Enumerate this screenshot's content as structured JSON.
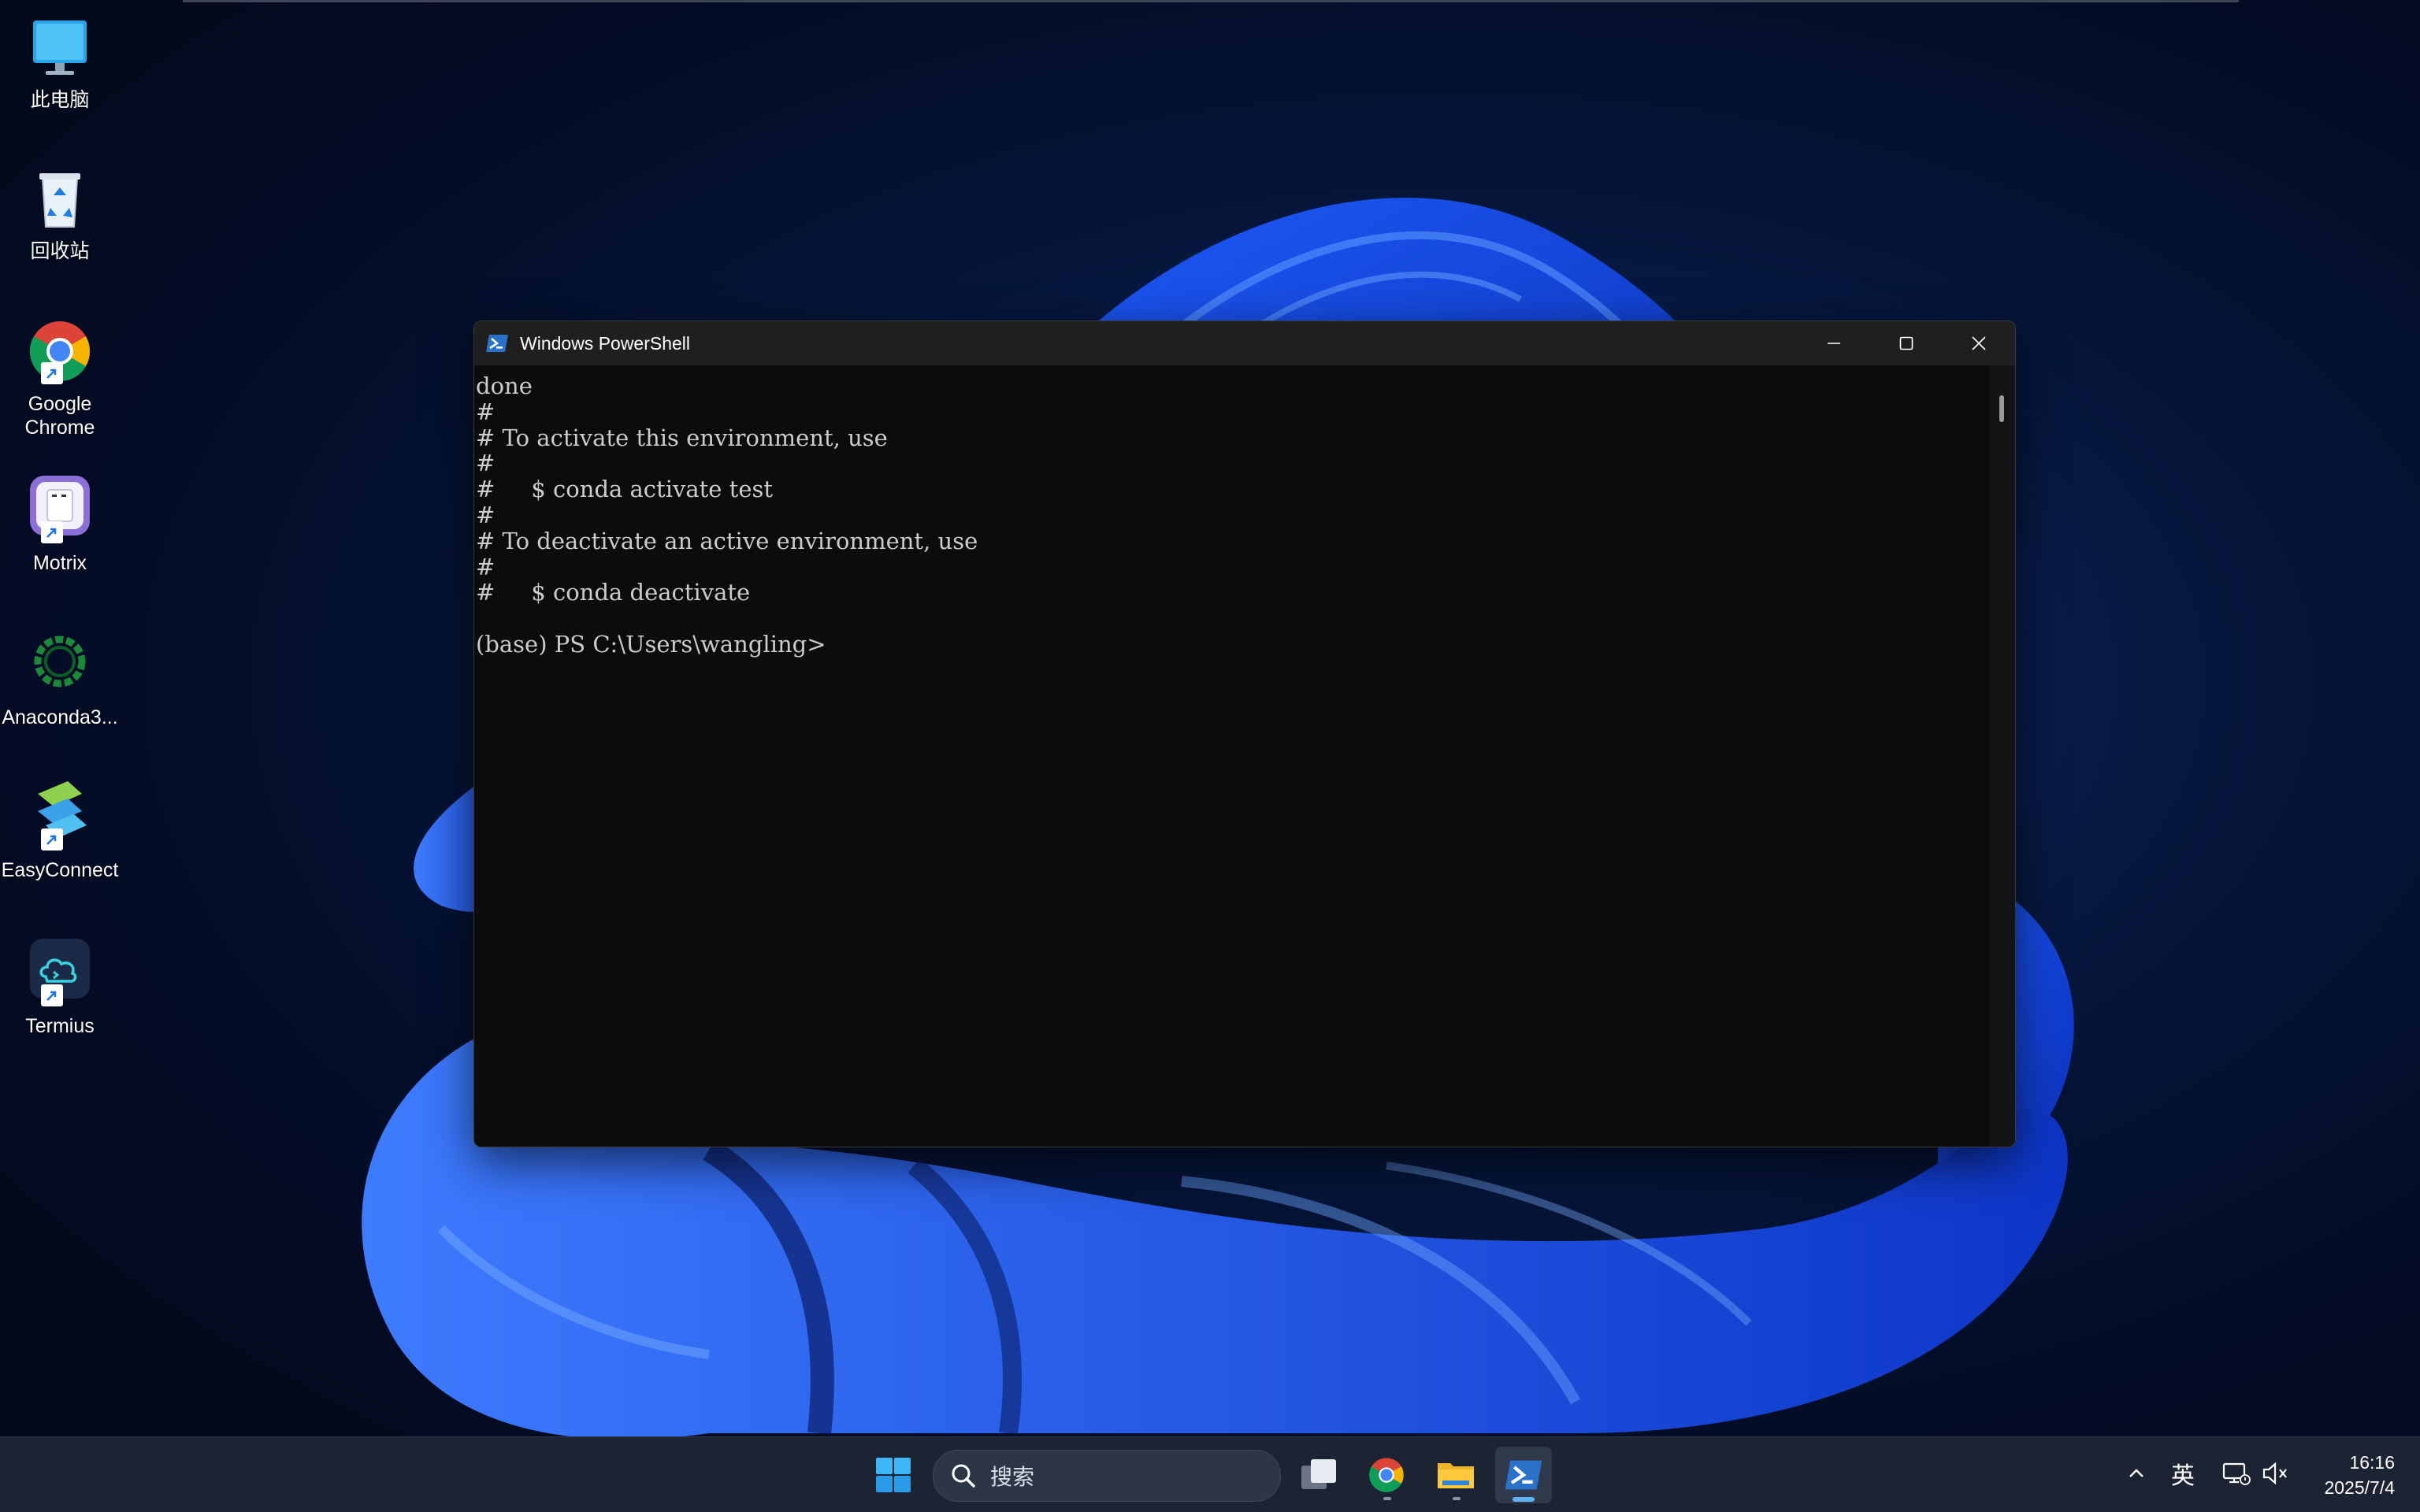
{
  "desktop": {
    "icons": [
      {
        "label": "此电脑",
        "icon": "monitor-icon"
      },
      {
        "label": "回收站",
        "icon": "recycle-bin-icon"
      },
      {
        "label": "Google Chrome",
        "icon": "chrome-icon"
      },
      {
        "label": "Motrix",
        "icon": "motrix-icon"
      },
      {
        "label": "Anaconda3...",
        "icon": "anaconda-icon"
      },
      {
        "label": "EasyConnect",
        "icon": "easyconnect-icon"
      },
      {
        "label": "Termius",
        "icon": "termius-icon"
      }
    ]
  },
  "window": {
    "title": "Windows PowerShell",
    "icon": "powershell-icon",
    "controls": [
      "minimize",
      "maximize",
      "close"
    ],
    "console_text": "done\n#\n# To activate this environment, use\n#\n#     $ conda activate test\n#\n# To deactivate an active environment, use\n#\n#     $ conda deactivate\n\n(base) PS C:\\Users\\wangling>"
  },
  "taskbar": {
    "search_placeholder": "搜索",
    "apps": [
      "start-icon",
      "task-view-icon",
      "chrome-icon",
      "file-explorer-icon",
      "powershell-icon"
    ],
    "tray": {
      "ime": "英",
      "time": "16:16",
      "date": "2025/7/4"
    }
  },
  "colors": {
    "console_bg": "#0c0c0c",
    "console_fg": "#cccccc",
    "titlebar": "#1f1f1f",
    "taskbar": "#1c2433",
    "accent": "#5fb2f2"
  }
}
